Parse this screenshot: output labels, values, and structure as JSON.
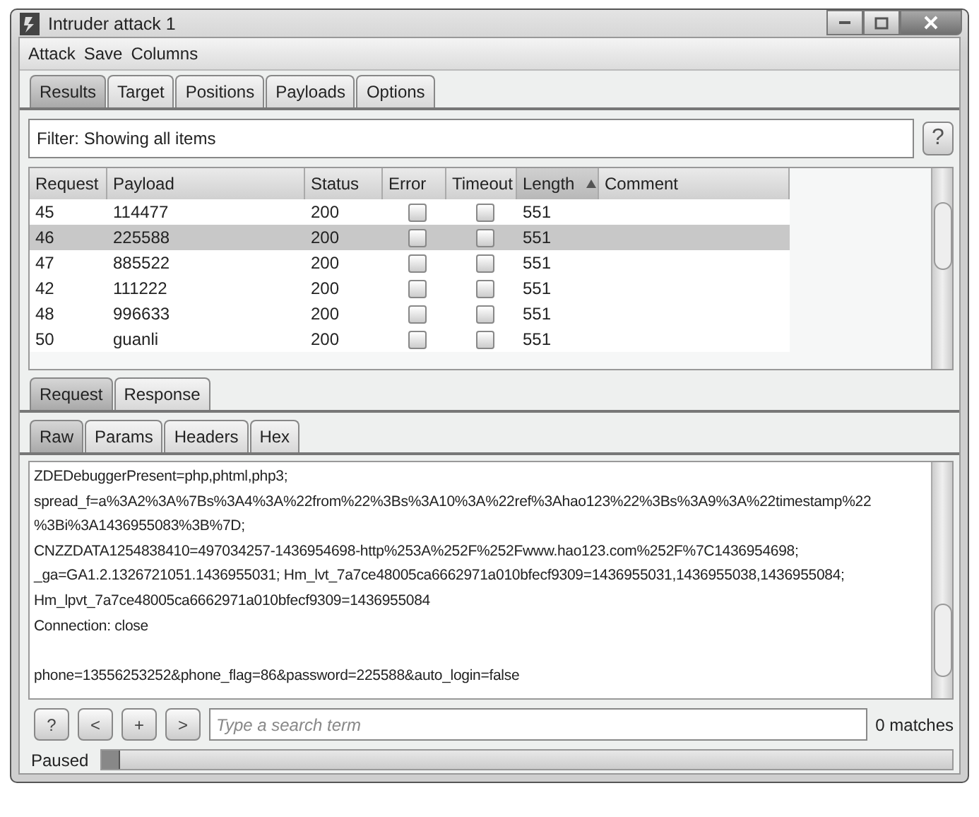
{
  "window": {
    "title": "Intruder attack 1"
  },
  "menu": [
    "Attack",
    "Save",
    "Columns"
  ],
  "tabs": [
    {
      "label": "Results",
      "selected": true
    },
    {
      "label": "Target",
      "selected": false
    },
    {
      "label": "Positions",
      "selected": false
    },
    {
      "label": "Payloads",
      "selected": false
    },
    {
      "label": "Options",
      "selected": false
    }
  ],
  "filter": {
    "text": "Filter: Showing all items",
    "help": "?"
  },
  "table": {
    "columns": [
      {
        "label": "Request",
        "sorted": false
      },
      {
        "label": "Payload",
        "sorted": false
      },
      {
        "label": "Status",
        "sorted": false
      },
      {
        "label": "Error",
        "sorted": false
      },
      {
        "label": "Timeout",
        "sorted": false
      },
      {
        "label": "Length",
        "sorted": true
      },
      {
        "label": "Comment",
        "sorted": false
      }
    ],
    "rows": [
      {
        "request": "45",
        "payload": "114477",
        "status": "200",
        "error": false,
        "timeout": false,
        "length": "551",
        "selected": false
      },
      {
        "request": "46",
        "payload": "225588",
        "status": "200",
        "error": false,
        "timeout": false,
        "length": "551",
        "selected": true
      },
      {
        "request": "47",
        "payload": "885522",
        "status": "200",
        "error": false,
        "timeout": false,
        "length": "551",
        "selected": false
      },
      {
        "request": "42",
        "payload": "111222",
        "status": "200",
        "error": false,
        "timeout": false,
        "length": "551",
        "selected": false
      },
      {
        "request": "48",
        "payload": "996633",
        "status": "200",
        "error": false,
        "timeout": false,
        "length": "551",
        "selected": false
      },
      {
        "request": "50",
        "payload": "guanli",
        "status": "200",
        "error": false,
        "timeout": false,
        "length": "551",
        "selected": false
      }
    ]
  },
  "message_tabs": [
    {
      "label": "Request",
      "selected": true
    },
    {
      "label": "Response",
      "selected": false
    }
  ],
  "view_tabs": [
    {
      "label": "Raw",
      "selected": true
    },
    {
      "label": "Params",
      "selected": false
    },
    {
      "label": "Headers",
      "selected": false
    },
    {
      "label": "Hex",
      "selected": false
    }
  ],
  "raw_lines": [
    "ZDEDebuggerPresent=php,phtml,php3;",
    "spread_f=a%3A2%3A%7Bs%3A4%3A%22from%22%3Bs%3A10%3A%22ref%3Ahao123%22%3Bs%3A9%3A%22timestamp%22",
    "%3Bi%3A1436955083%3B%7D;",
    "CNZZDATA1254838410=497034257-1436954698-http%253A%252F%252Fwww.hao123.com%252F%7C1436954698;",
    "_ga=GA1.2.1326721051.1436955031; Hm_lvt_7a7ce48005ca6662971a010bfecf9309=1436955031,1436955038,1436955084;",
    "Hm_lpvt_7a7ce48005ca6662971a010bfecf9309=1436955084",
    "Connection: close"
  ],
  "raw_body": "phone=13556253252&phone_flag=86&password=225588&auto_login=false",
  "search": {
    "buttons": [
      "?",
      "<",
      "+",
      ">"
    ],
    "placeholder": "Type a search term",
    "matches": "0 matches"
  },
  "status": {
    "text": "Paused",
    "level": 0
  }
}
